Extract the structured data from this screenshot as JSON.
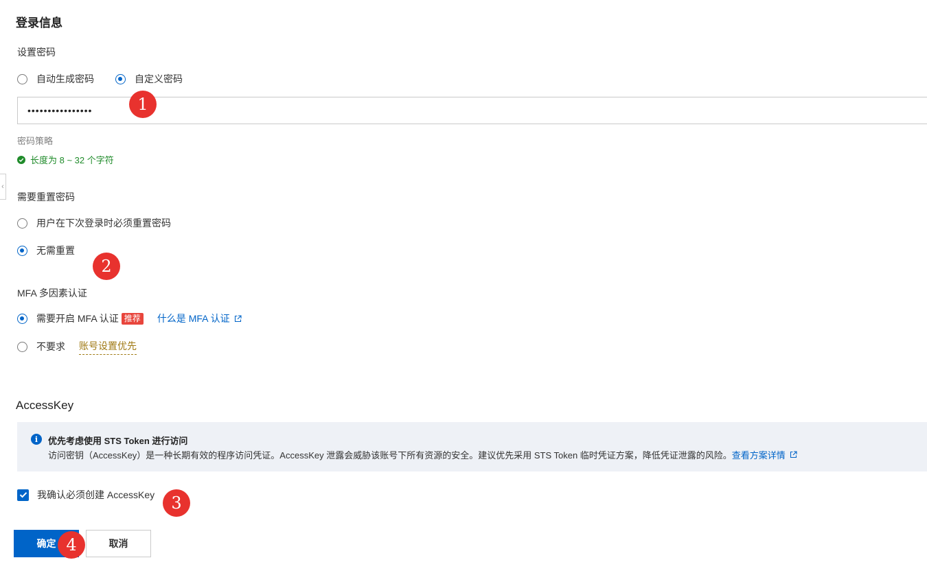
{
  "login_section": {
    "title": "登录信息",
    "set_password_label": "设置密码",
    "password_mode_options": [
      {
        "label": "自动生成密码",
        "selected": false
      },
      {
        "label": "自定义密码",
        "selected": true
      }
    ],
    "password_value": "••••••••••••••••",
    "policy_label": "密码策略",
    "policy_rule": "长度为 8 ~ 32 个字符",
    "reset_label": "需要重置密码",
    "reset_options": [
      {
        "label": "用户在下次登录时必须重置密码",
        "selected": false
      },
      {
        "label": "无需重置",
        "selected": true
      }
    ],
    "mfa_label": "MFA 多因素认证",
    "mfa_options": [
      {
        "label": "需要开启 MFA 认证",
        "selected": true,
        "badge": "推荐",
        "link": "什么是 MFA 认证"
      },
      {
        "label": "不要求",
        "selected": false,
        "link": "账号设置优先"
      }
    ]
  },
  "accesskey_section": {
    "title": "AccessKey",
    "notice_title": "优先考虑使用 STS Token 进行访问",
    "notice_body": "访问密钥（AccessKey）是一种长期有效的程序访问凭证。AccessKey 泄露会威胁该账号下所有资源的安全。建议优先采用 STS Token 临时凭证方案，降低凭证泄露的风险。",
    "notice_link": "查看方案详情",
    "confirm_checkbox_label": "我确认必须创建 AccessKey",
    "confirm_checked": true
  },
  "actions": {
    "ok_label": "确定",
    "cancel_label": "取消"
  },
  "markers": [
    "1",
    "2",
    "3",
    "4"
  ],
  "icons": [
    "info-icon",
    "check-circle-icon",
    "external-link-icon",
    "checkmark-icon",
    "chevron-left-icon"
  ],
  "colors": {
    "primary": "#0064c8",
    "success": "#1f8b2a",
    "badge": "#e8453c",
    "marker": "#e8322e",
    "notice_bg": "#eef1f6",
    "warning_link": "#a07a14"
  }
}
